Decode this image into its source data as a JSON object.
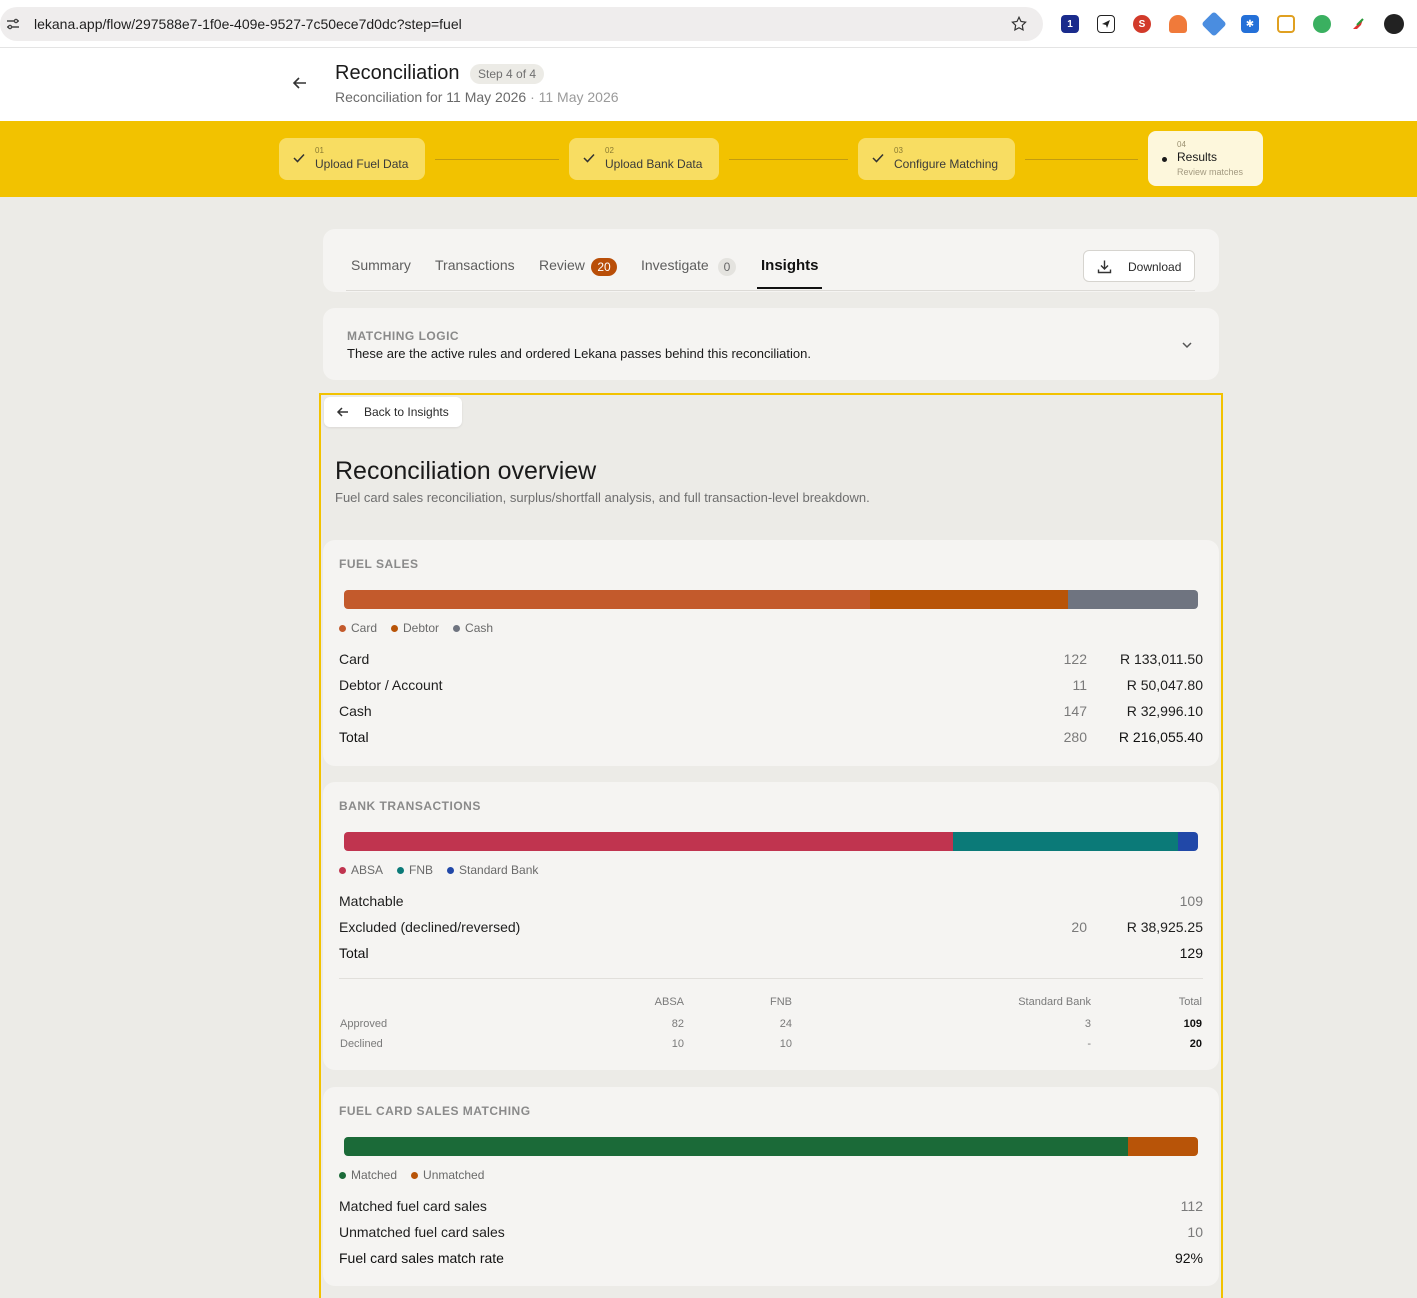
{
  "browser": {
    "url": "lekana.app/flow/297588e7-1f0e-409e-9527-7c50ece7d0dc?step=fuel"
  },
  "header": {
    "title": "Reconciliation",
    "step_badge": "Step 4 of 4",
    "subtitle": "Reconciliation for 11 May 2026",
    "subtitle_date": "· 11 May 2026"
  },
  "stepper": {
    "steps": [
      {
        "num": "01",
        "label": "Upload Fuel Data"
      },
      {
        "num": "02",
        "label": "Upload Bank Data"
      },
      {
        "num": "03",
        "label": "Configure Matching"
      }
    ],
    "active": {
      "num": "04",
      "label": "Results",
      "sub": "Review matches"
    }
  },
  "tabs": {
    "items": [
      {
        "label": "Summary"
      },
      {
        "label": "Transactions"
      },
      {
        "label": "Review",
        "badge": "20"
      },
      {
        "label": "Investigate",
        "badge": "0"
      },
      {
        "label": "Insights"
      }
    ],
    "download_label": "Download"
  },
  "matching_logic": {
    "caption": "MATCHING LOGIC",
    "description": "These are the active rules and ordered Lekana passes behind this reconciliation."
  },
  "overview": {
    "back_label": "Back to Insights",
    "title": "Reconciliation overview",
    "subtitle": "Fuel card sales reconciliation, surplus/shortfall analysis, and full transaction-level breakdown."
  },
  "fuel_sales": {
    "caption": "FUEL SALES",
    "bar": [
      {
        "name": "Card",
        "value": 133011.5,
        "color": "#c35a2c"
      },
      {
        "name": "Debtor",
        "value": 50047.8,
        "color": "#b85408"
      },
      {
        "name": "Cash",
        "value": 32996.1,
        "color": "#6f7480"
      }
    ],
    "rows": [
      {
        "label": "Card",
        "count": "122",
        "amount": "R 133,011.50"
      },
      {
        "label": "Debtor / Account",
        "count": "11",
        "amount": "R 50,047.80"
      },
      {
        "label": "Cash",
        "count": "147",
        "amount": "R 32,996.10"
      },
      {
        "label": "Total",
        "count": "280",
        "amount": "R 216,055.40"
      }
    ]
  },
  "bank_transactions": {
    "caption": "BANK TRANSACTIONS",
    "bar": [
      {
        "name": "ABSA",
        "value": 92,
        "color": "#c0344f"
      },
      {
        "name": "FNB",
        "value": 34,
        "color": "#0b7a78"
      },
      {
        "name": "Standard Bank",
        "value": 3,
        "color": "#2148a8"
      }
    ],
    "rows": [
      {
        "label": "Matchable",
        "count": "109"
      },
      {
        "label": "Excluded (declined/reversed)",
        "count": "20",
        "amount": "R 38,925.25"
      },
      {
        "label": "Total",
        "count": "129"
      }
    ],
    "table": {
      "headers": [
        "ABSA",
        "FNB",
        "Standard Bank",
        "Total"
      ],
      "rows": [
        {
          "label": "Approved",
          "values": [
            "82",
            "24",
            "3",
            "109"
          ]
        },
        {
          "label": "Declined",
          "values": [
            "10",
            "10",
            "-",
            "20"
          ]
        }
      ]
    }
  },
  "fuel_card_matching": {
    "caption": "FUEL CARD SALES MATCHING",
    "bar": [
      {
        "name": "Matched",
        "value": 112,
        "color": "#1b6a38"
      },
      {
        "name": "Unmatched",
        "value": 10,
        "color": "#b85408"
      }
    ],
    "rows": [
      {
        "label": "Matched fuel card sales",
        "count": "112"
      },
      {
        "label": "Unmatched fuel card sales",
        "count": "10"
      },
      {
        "label": "Fuel card sales match rate",
        "count": "92%"
      }
    ]
  }
}
